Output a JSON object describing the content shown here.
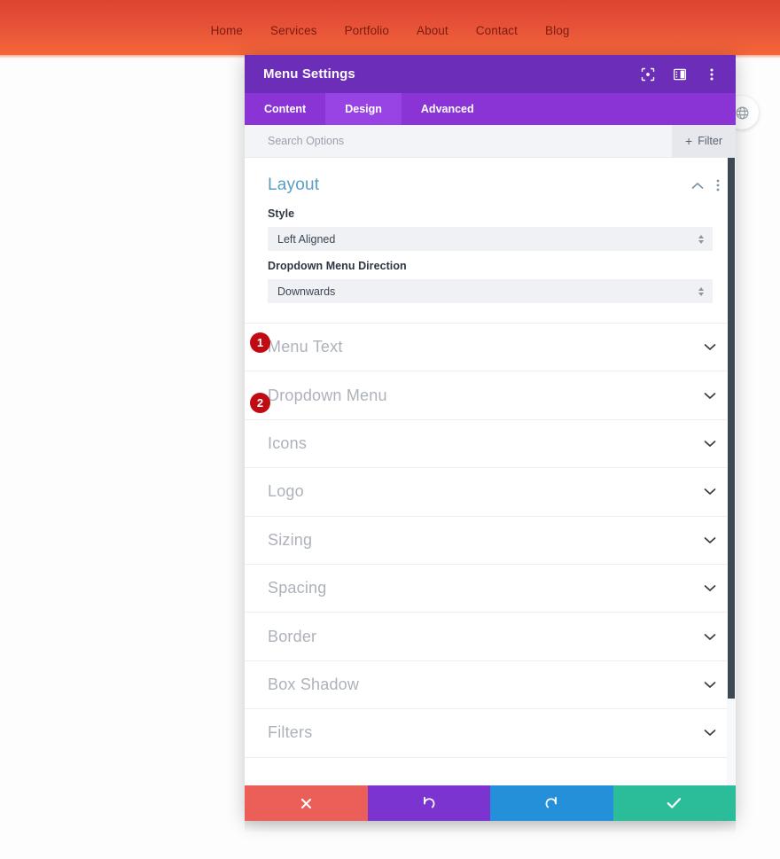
{
  "site": {
    "nav_items": [
      {
        "label": "Home"
      },
      {
        "label": "Services"
      },
      {
        "label": "Portfolio"
      },
      {
        "label": "About"
      },
      {
        "label": "Contact"
      },
      {
        "label": "Blog"
      }
    ],
    "header_gradient_top": "#dd4332",
    "header_gradient_bottom": "#f4663a",
    "nav_link_color": "#7a1c10",
    "globe_icon": "globe-icon"
  },
  "modal": {
    "title": "Menu Settings",
    "titlebar_color": "#6c2eb9",
    "titlebar_icons": [
      {
        "name": "focus-target-icon"
      },
      {
        "name": "panel-layout-icon"
      },
      {
        "name": "more-vertical-icon"
      }
    ],
    "tabs": [
      {
        "label": "Content",
        "active": false
      },
      {
        "label": "Design",
        "active": true
      },
      {
        "label": "Advanced",
        "active": false
      }
    ],
    "tabs_bar_color": "#8b34d6",
    "tab_active_color": "#9843e4",
    "search": {
      "placeholder": "Search Options",
      "value": ""
    },
    "filter_button": {
      "label": "Filter",
      "plus": "+"
    },
    "layout_section": {
      "title": "Layout",
      "title_color": "#5b9ec4",
      "collapse_icon": "chevron-up-icon",
      "menu_icon": "more-vertical-icon",
      "fields": [
        {
          "label": "Style",
          "value": "Left Aligned",
          "marker": "1"
        },
        {
          "label": "Dropdown Menu Direction",
          "value": "Downwards",
          "marker": "2"
        }
      ]
    },
    "collapsed_sections": [
      {
        "label": "Menu Text"
      },
      {
        "label": "Dropdown Menu"
      },
      {
        "label": "Icons"
      },
      {
        "label": "Logo"
      },
      {
        "label": "Sizing"
      },
      {
        "label": "Spacing"
      },
      {
        "label": "Border"
      },
      {
        "label": "Box Shadow"
      },
      {
        "label": "Filters"
      }
    ],
    "footer_buttons": [
      {
        "name": "cancel-button",
        "icon": "close-x-icon",
        "color": "#ec5f58"
      },
      {
        "name": "undo-button",
        "icon": "undo-arrow-icon",
        "color": "#7b34cf"
      },
      {
        "name": "redo-button",
        "icon": "redo-arrow-icon",
        "color": "#2490d9"
      },
      {
        "name": "save-button",
        "icon": "check-icon",
        "color": "#2bbd9a"
      }
    ],
    "marker_color": "#c00b12",
    "scrollbar_thumb_color": "#3d4852"
  }
}
